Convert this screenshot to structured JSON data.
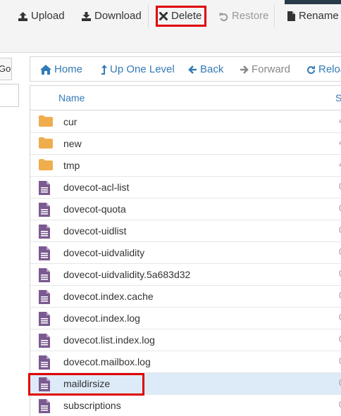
{
  "toolbar": {
    "upload": "Upload",
    "download": "Download",
    "delete": "Delete",
    "restore": "Restore",
    "rename": "Rename"
  },
  "left_panel": {
    "go": "Go"
  },
  "nav": {
    "home": "Home",
    "up_one_level": "Up One Level",
    "back": "Back",
    "forward": "Forward",
    "reload": "Reload"
  },
  "table": {
    "col_name": "Name",
    "col_size": "S",
    "rows": [
      {
        "name": "cur",
        "type": "folder",
        "tail": "4"
      },
      {
        "name": "new",
        "type": "folder",
        "tail": "4"
      },
      {
        "name": "tmp",
        "type": "folder",
        "tail": "4"
      },
      {
        "name": "dovecot-acl-list",
        "type": "file",
        "tail": "0"
      },
      {
        "name": "dovecot-quota",
        "type": "file",
        "tail": "0"
      },
      {
        "name": "dovecot-uidlist",
        "type": "file",
        "tail": "0"
      },
      {
        "name": "dovecot-uidvalidity",
        "type": "file",
        "tail": "0"
      },
      {
        "name": "dovecot-uidvalidity.5a683d32",
        "type": "file",
        "tail": "0"
      },
      {
        "name": "dovecot.index.cache",
        "type": "file",
        "tail": "0"
      },
      {
        "name": "dovecot.index.log",
        "type": "file",
        "tail": "0"
      },
      {
        "name": "dovecot.list.index.log",
        "type": "file",
        "tail": "0"
      },
      {
        "name": "dovecot.mailbox.log",
        "type": "file",
        "tail": "0"
      },
      {
        "name": "maildirsize",
        "type": "file",
        "tail": "0",
        "selected": true
      },
      {
        "name": "subscriptions",
        "type": "file",
        "tail": "0"
      }
    ]
  },
  "colors": {
    "link": "#337ab7",
    "folder": "#f0ad4e",
    "file": "#7b5a91",
    "highlight": "#e00000",
    "selected_row": "#dcebf7"
  },
  "icons": {
    "upload": "upload-icon",
    "download": "download-icon",
    "delete": "times-icon",
    "restore": "undo-icon",
    "rename": "file-icon",
    "home": "home-icon",
    "up": "level-up-icon",
    "back": "arrow-left-icon",
    "forward": "arrow-right-icon",
    "reload": "refresh-icon"
  }
}
